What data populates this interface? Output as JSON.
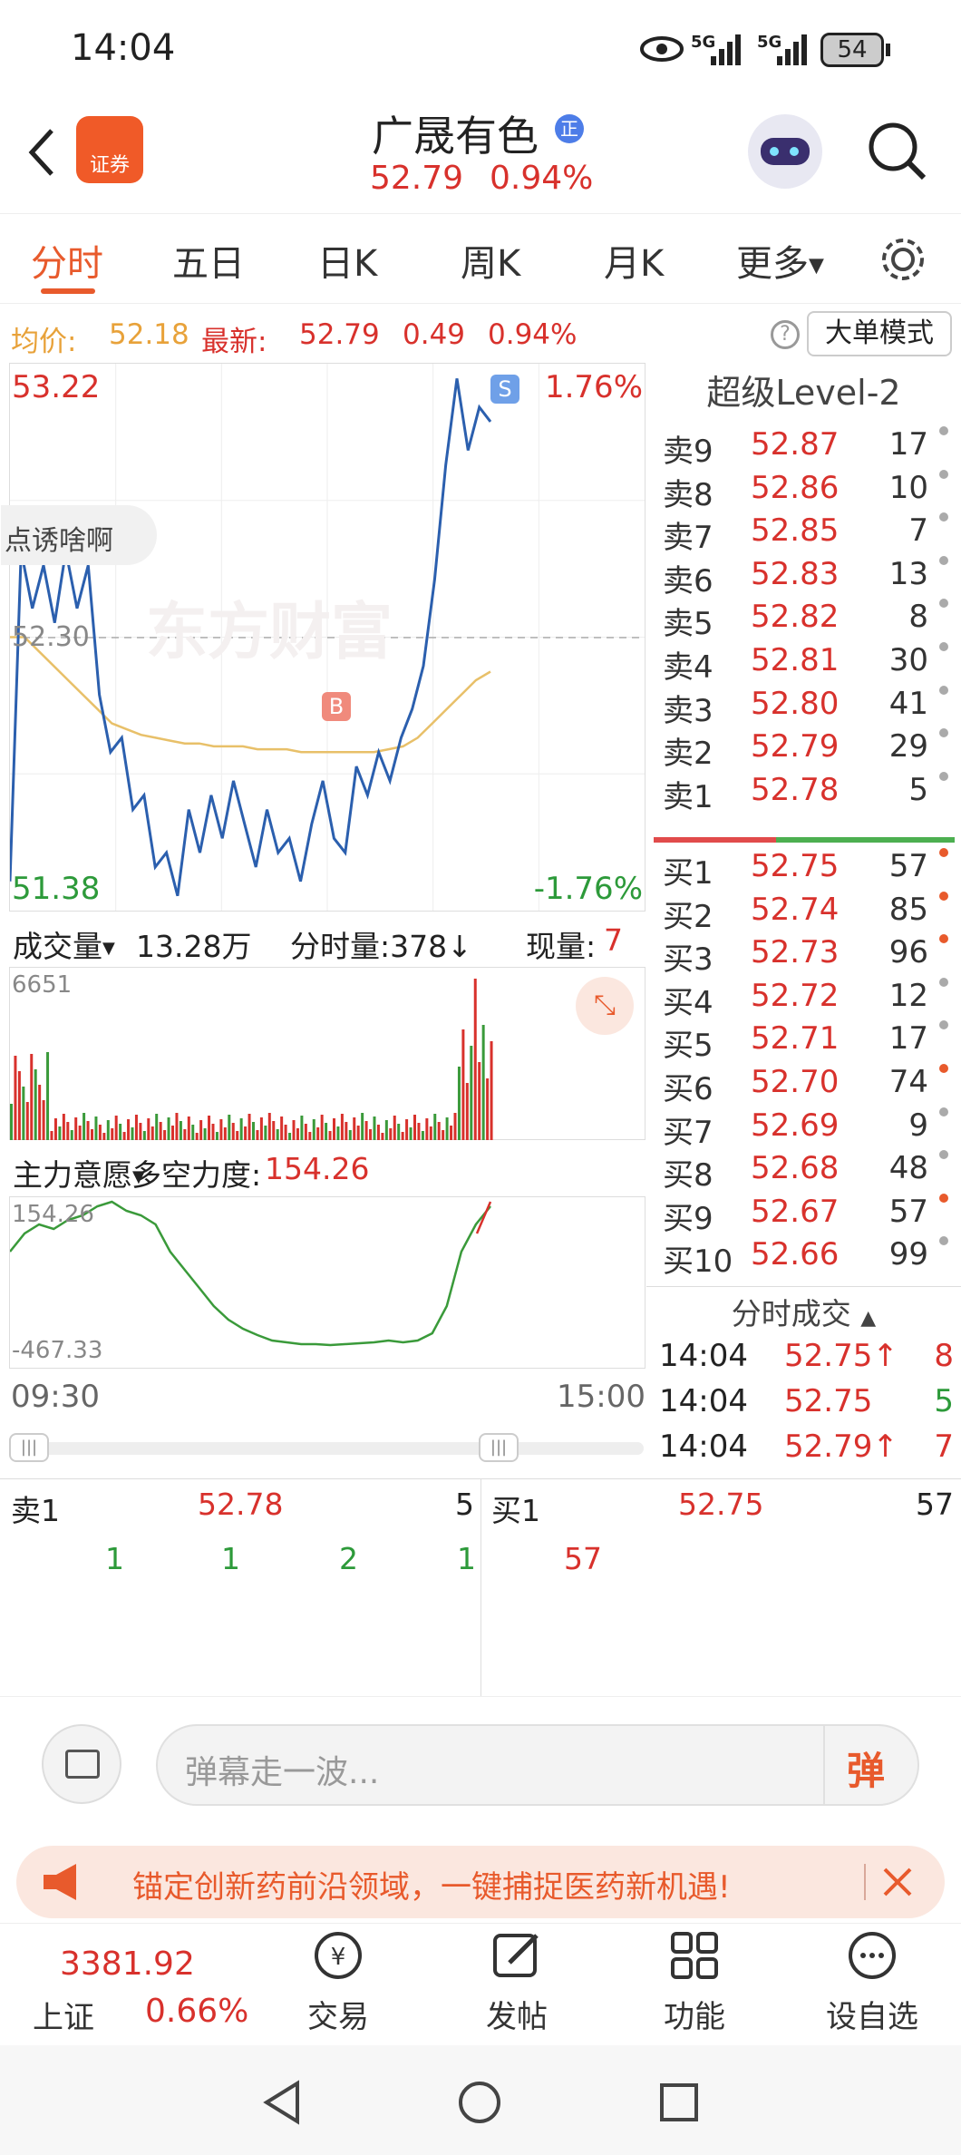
{
  "status": {
    "time": "14:04",
    "net1": "5G",
    "net2": "5G",
    "battery": "54"
  },
  "header": {
    "title": "广晟有色",
    "badge": "正",
    "price": "52.79",
    "change_pct": "0.94%",
    "app_logo": "证券"
  },
  "tabs": [
    "分时",
    "五日",
    "日K",
    "周K",
    "月K",
    "更多"
  ],
  "infobar": {
    "avg_label": "均价:",
    "avg": "52.18",
    "latest_label": "最新:",
    "latest": "52.79",
    "chg": "0.49",
    "chg_pct": "0.94%",
    "mode_btn": "大单模式"
  },
  "chart_meta": {
    "high": "53.22",
    "low": "51.38",
    "high_pct": "1.76%",
    "low_pct": "-1.76%",
    "mid": "52.30",
    "popup": "点诱啥啊",
    "watermark": "东方财富",
    "buy_marker": "B",
    "sell_marker": "S"
  },
  "chart_data": {
    "type": "line",
    "x_start": "09:30",
    "x_end": "15:00",
    "ylim": [
      51.38,
      53.22
    ],
    "series": [
      {
        "values": [
          51.45,
          52.6,
          52.4,
          52.55,
          52.35,
          52.6,
          52.4,
          52.55,
          52.1,
          51.9,
          51.95,
          51.7,
          51.75,
          51.5,
          51.55,
          51.4,
          51.7,
          51.55,
          51.75,
          51.6,
          51.8,
          51.65,
          51.5,
          51.7,
          51.55,
          51.6,
          51.45,
          51.65,
          51.8,
          51.6,
          51.55,
          51.85,
          51.75,
          51.9,
          51.8,
          51.95,
          52.05,
          52.2,
          52.5,
          52.9,
          53.2,
          52.95,
          53.1,
          53.05
        ]
      },
      {
        "values": [
          52.3,
          52.3,
          52.25,
          52.2,
          52.15,
          52.1,
          52.05,
          52.0,
          51.98,
          51.96,
          51.95,
          51.94,
          51.93,
          51.93,
          51.92,
          51.92,
          51.92,
          51.91,
          51.91,
          51.91,
          51.9,
          51.9,
          51.9,
          51.9,
          51.9,
          51.9,
          51.91,
          51.92,
          51.95,
          52.0,
          52.05,
          52.1,
          52.15,
          52.18
        ]
      }
    ]
  },
  "orderbook": {
    "title": "超级Level-2",
    "sells": [
      {
        "label": "卖9",
        "price": "52.87",
        "vol": "17"
      },
      {
        "label": "卖8",
        "price": "52.86",
        "vol": "10"
      },
      {
        "label": "卖7",
        "price": "52.85",
        "vol": "7"
      },
      {
        "label": "卖6",
        "price": "52.83",
        "vol": "13"
      },
      {
        "label": "卖5",
        "price": "52.82",
        "vol": "8"
      },
      {
        "label": "卖4",
        "price": "52.81",
        "vol": "30"
      },
      {
        "label": "卖3",
        "price": "52.80",
        "vol": "41"
      },
      {
        "label": "卖2",
        "price": "52.79",
        "vol": "29"
      },
      {
        "label": "卖1",
        "price": "52.78",
        "vol": "5"
      }
    ],
    "buys": [
      {
        "label": "买1",
        "price": "52.75",
        "vol": "57"
      },
      {
        "label": "买2",
        "price": "52.74",
        "vol": "85"
      },
      {
        "label": "买3",
        "price": "52.73",
        "vol": "96"
      },
      {
        "label": "买4",
        "price": "52.72",
        "vol": "12"
      },
      {
        "label": "买5",
        "price": "52.71",
        "vol": "17"
      },
      {
        "label": "买6",
        "price": "52.70",
        "vol": "74"
      },
      {
        "label": "买7",
        "price": "52.69",
        "vol": "9"
      },
      {
        "label": "买8",
        "price": "52.68",
        "vol": "48"
      },
      {
        "label": "买9",
        "price": "52.67",
        "vol": "57"
      },
      {
        "label": "买10",
        "price": "52.66",
        "vol": "99"
      }
    ],
    "trades_title": "分时成交",
    "trades": [
      {
        "time": "14:04",
        "price": "52.75↑",
        "vol": "8"
      },
      {
        "time": "14:04",
        "price": "52.75",
        "vol": "5"
      },
      {
        "time": "14:04",
        "price": "52.79↑",
        "vol": "7"
      }
    ]
  },
  "volume": {
    "label": "成交量",
    "total": "13.28万",
    "minute_label": "分时量:378↓",
    "now_label": "现量:",
    "now": "7",
    "max": "6651"
  },
  "force": {
    "label": "主力意愿",
    "title": "多空力度:",
    "value": "154.26",
    "top": "154.26",
    "bottom": "-467.33"
  },
  "level2": {
    "sell_label": "卖1",
    "sell_price": "52.78",
    "sell_vol": "5",
    "buy_label": "买1",
    "buy_price": "52.75",
    "buy_vol": "57",
    "sell_queue": [
      "1",
      "1",
      "2",
      "1"
    ],
    "buy_queue": [
      "57"
    ]
  },
  "danmu": {
    "placeholder": "弹幕走一波...",
    "btn": "弹"
  },
  "ad": {
    "text": "锚定创新药前沿领域，一键捕捉医药新机遇!"
  },
  "bottom": {
    "index_value": "3381.92",
    "index_name": "上证",
    "index_pct": "0.66%",
    "items": [
      "交易",
      "发帖",
      "功能",
      "设自选"
    ]
  }
}
